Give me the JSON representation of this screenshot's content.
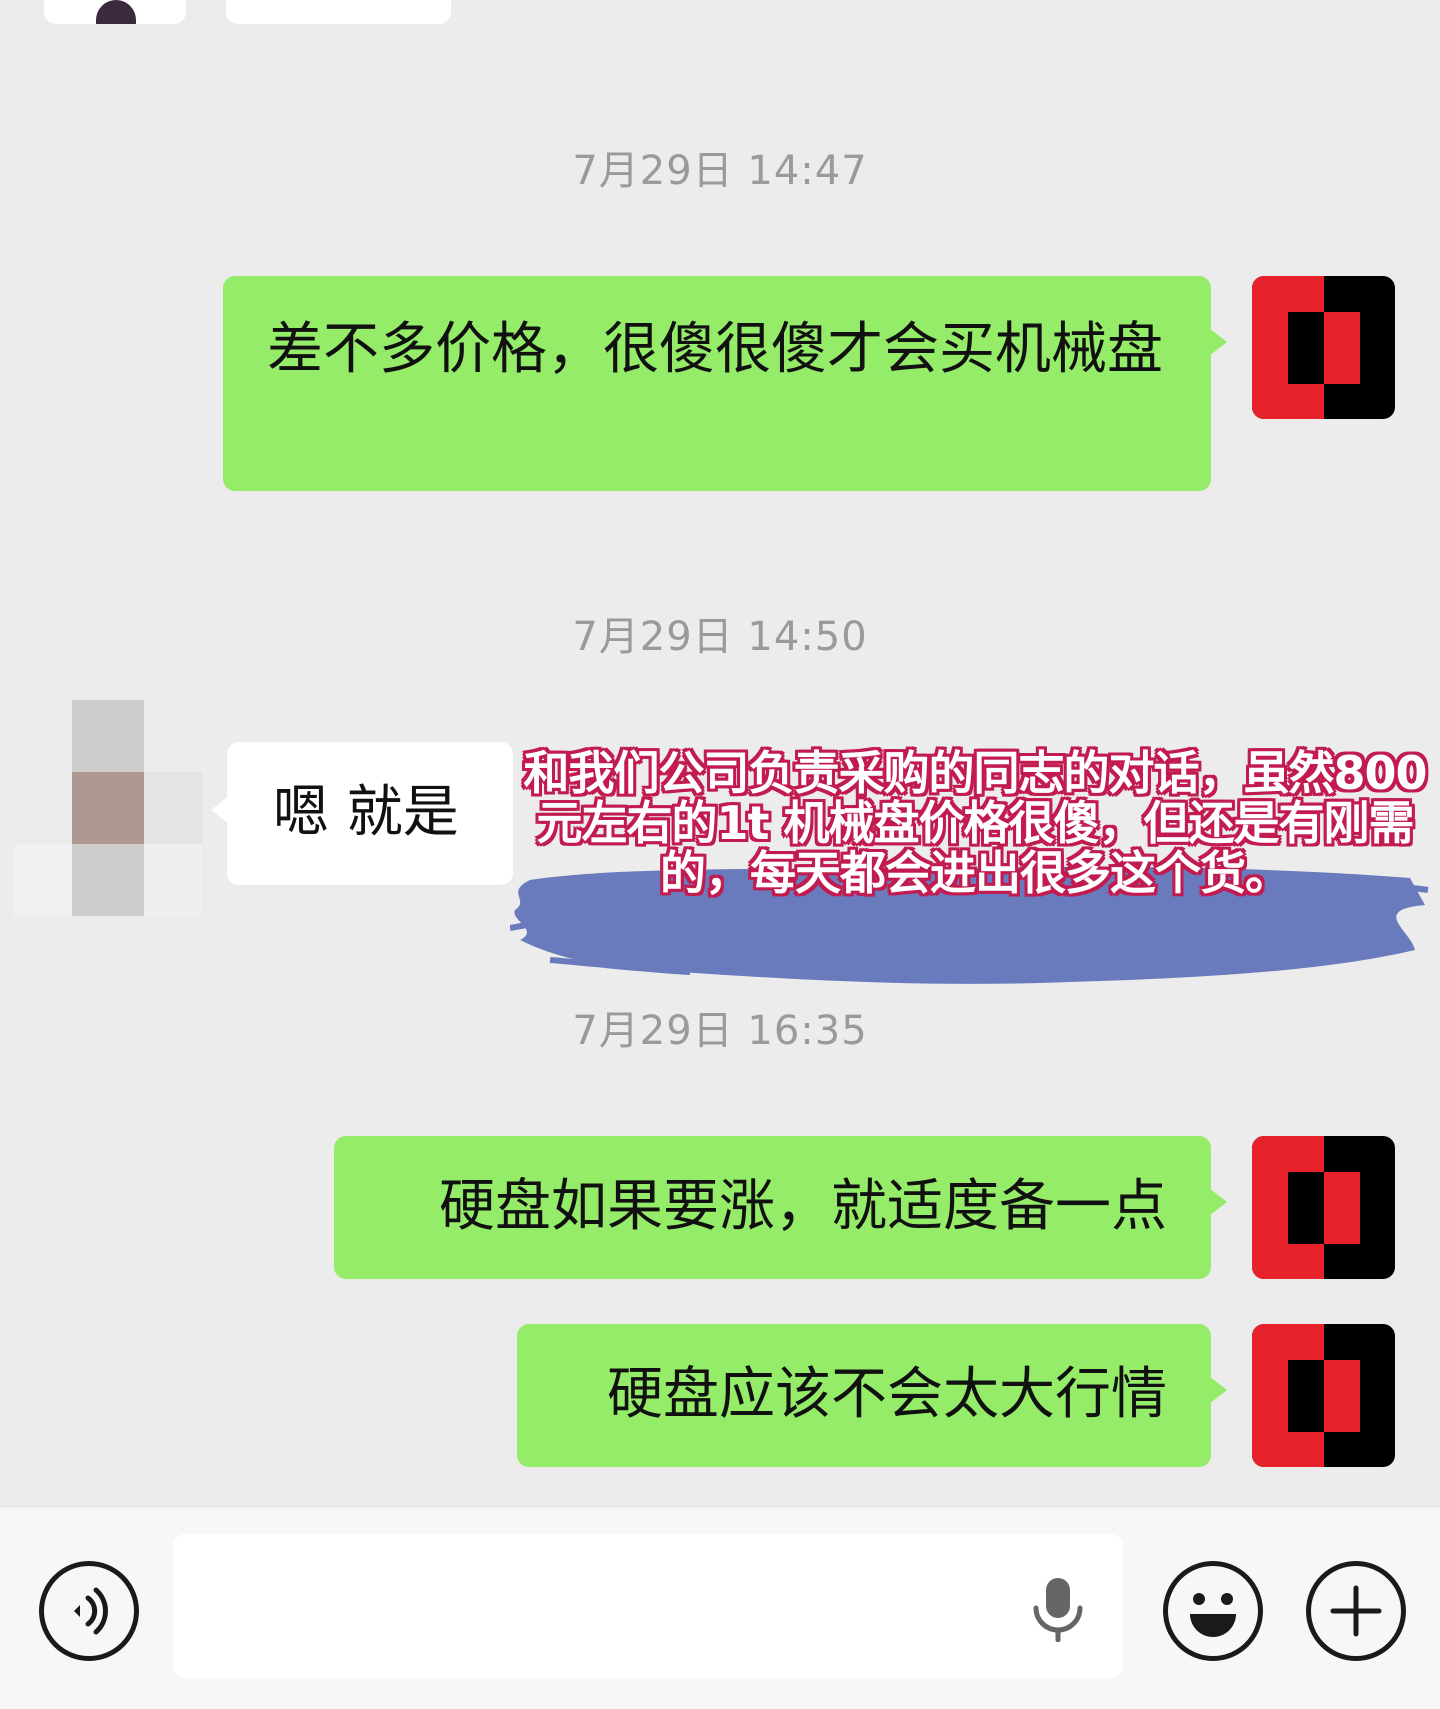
{
  "chat": {
    "messages": [
      {
        "type": "timestamp",
        "text": "7月29日 14:47"
      },
      {
        "type": "sent",
        "text": "差不多价格，很傻很傻才会买机械盘"
      },
      {
        "type": "timestamp",
        "text": "7月29日 14:50"
      },
      {
        "type": "received",
        "text": "嗯 就是"
      },
      {
        "type": "timestamp",
        "text": "7月29日 16:35"
      },
      {
        "type": "sent",
        "text": "硬盘如果要涨，就适度备一点"
      },
      {
        "type": "sent",
        "text": "硬盘应该不会太大行情"
      }
    ],
    "overlay_annotation": "和我们公司负责采购的同志的对话，虽然800元左右的1t 机械盘价格很傻，但还是有刚需的，每天都会进出很多这个货。"
  },
  "input_bar": {
    "voice_icon": "voice-icon",
    "mic_icon": "microphone-icon",
    "emoji_icon": "emoji-icon",
    "plus_icon": "plus-icon"
  },
  "colors": {
    "chat_background": "#ececec",
    "sent_bubble": "#95ec69",
    "received_bubble": "#ffffff",
    "timestamp": "#9a9a9a",
    "avatar_red": "#e8222a",
    "overlay_stroke": "#c21b4f",
    "overlay_smear": "#6a7bbd"
  }
}
